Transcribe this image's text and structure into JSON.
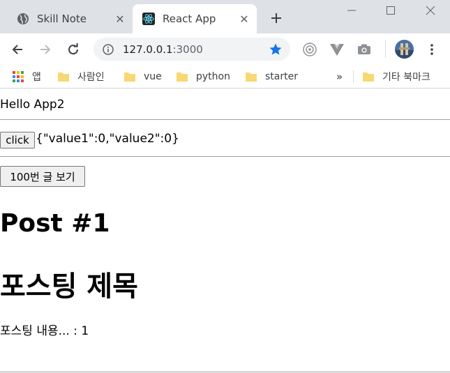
{
  "browser": {
    "tabs": [
      {
        "title": "Skill Note",
        "active": false,
        "favicon": "globe-icon"
      },
      {
        "title": "React App",
        "active": true,
        "favicon": "react-icon"
      }
    ],
    "address": {
      "host": "127.0.0.1",
      "port": ":3000"
    },
    "bookmarks": {
      "apps_label": "앱",
      "items": [
        "사람인",
        "vue",
        "python",
        "starter"
      ],
      "overflow": "»",
      "other": "기타 북마크"
    },
    "colors": {
      "tabstrip": "#dee1e6",
      "star": "#1a73e8",
      "folder": "#f8d775"
    }
  },
  "page": {
    "hello": "Hello App2",
    "click_button": "click",
    "state_text": "{\"value1\":0,\"value2\":0}",
    "view_post_button": "100번 글 보기",
    "post_heading": "Post #1",
    "post_title": "포스팅 제목",
    "post_content": "포스팅 내용... : 1"
  }
}
